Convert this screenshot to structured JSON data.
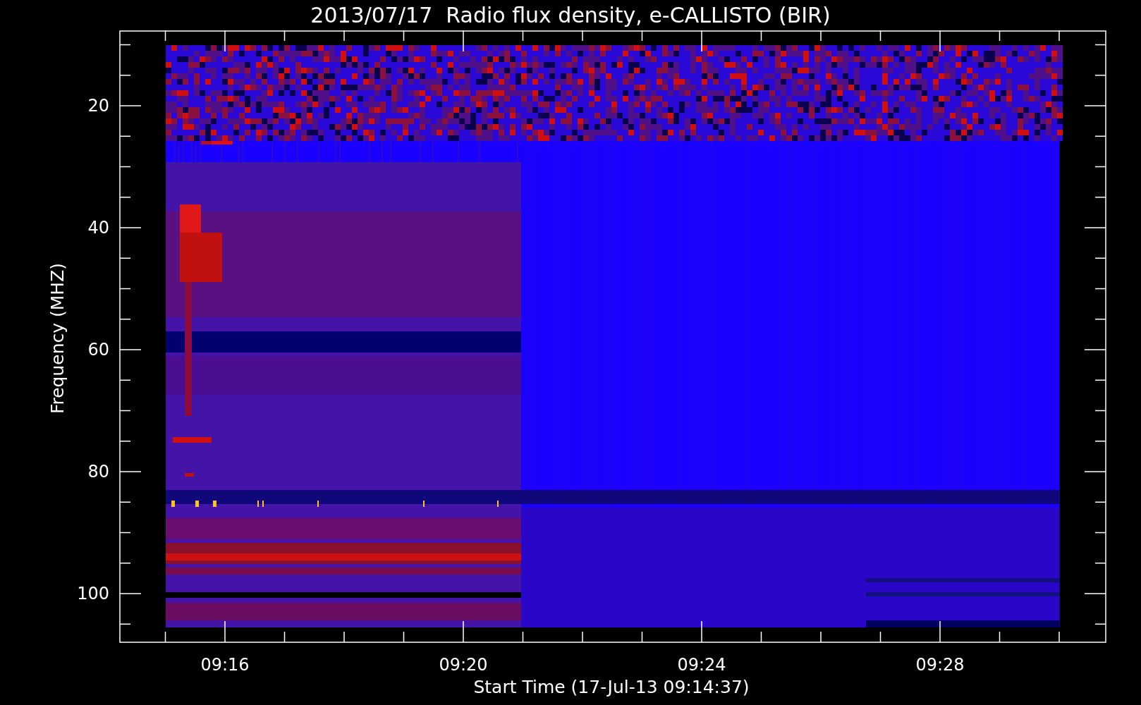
{
  "title": "2013/07/17  Radio flux density, e-CALLISTO (BIR)",
  "y_axis": {
    "label": "Frequency (MHZ)",
    "ticks": [
      "20",
      "40",
      "60",
      "80",
      "100"
    ]
  },
  "x_axis": {
    "label": "Start Time (17-Jul-13 09:14:37)",
    "ticks": [
      "09:16",
      "09:20",
      "09:24",
      "09:28"
    ]
  }
}
